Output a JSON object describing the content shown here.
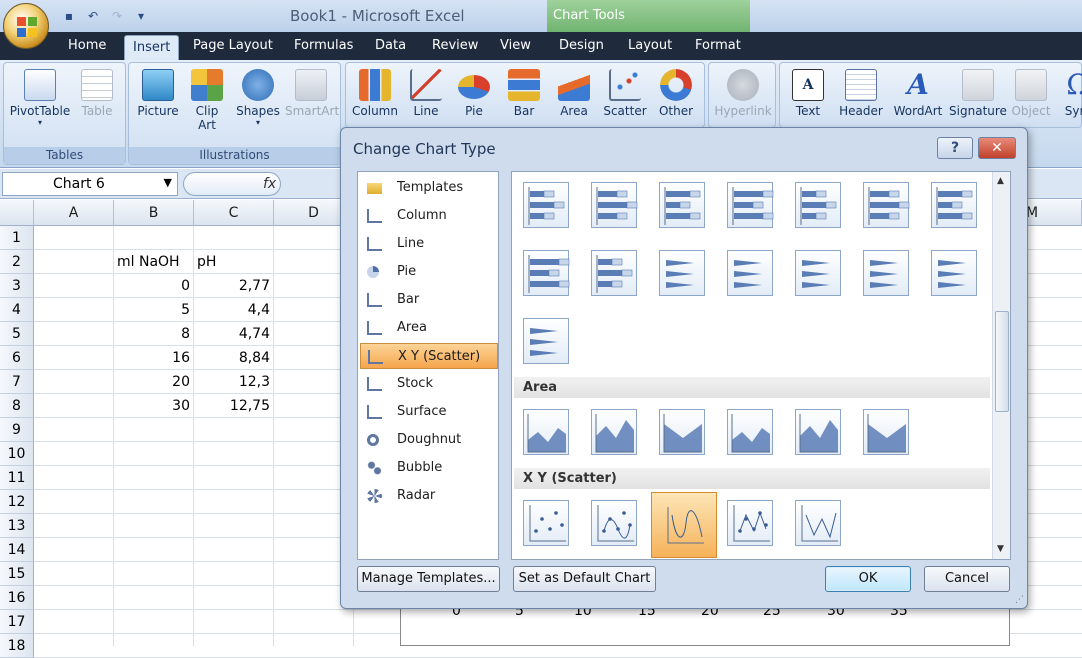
{
  "window": {
    "title": "Book1 - Microsoft Excel",
    "contextual_tab_group": "Chart Tools"
  },
  "tabs": [
    "Home",
    "Insert",
    "Page Layout",
    "Formulas",
    "Data",
    "Review",
    "View",
    "Design",
    "Layout",
    "Format"
  ],
  "active_tab": "Insert",
  "ribbon": {
    "groups": {
      "tables": "Tables",
      "illustrations": "Illustrations"
    },
    "tables": [
      "PivotTable",
      "Table"
    ],
    "illustrations": [
      "Picture",
      "Clip Art",
      "Shapes",
      "SmartArt"
    ],
    "charts": [
      "Column",
      "Line",
      "Pie",
      "Bar",
      "Area",
      "Scatter",
      "Other"
    ],
    "links": [
      "Hyperlink"
    ],
    "text": [
      "Text",
      "Header",
      "WordArt",
      "Signature",
      "Object",
      "Sym"
    ]
  },
  "formula_bar": {
    "name_box": "Chart 6",
    "fx": "fx"
  },
  "sheet": {
    "columns": [
      "A",
      "B",
      "C",
      "D",
      "M"
    ],
    "rows": [
      "1",
      "2",
      "3",
      "4",
      "5",
      "6",
      "7",
      "8",
      "9",
      "10",
      "11",
      "12",
      "13",
      "14",
      "15",
      "16",
      "17",
      "18"
    ],
    "header_b": "ml NaOH",
    "header_c": "pH",
    "data": [
      {
        "b": "0",
        "c": "2,77"
      },
      {
        "b": "5",
        "c": "4,4"
      },
      {
        "b": "8",
        "c": "4,74"
      },
      {
        "b": "16",
        "c": "8,84"
      },
      {
        "b": "20",
        "c": "12,3"
      },
      {
        "b": "30",
        "c": "12,75"
      }
    ],
    "chart_x_ticks": [
      "0",
      "5",
      "10",
      "15",
      "20",
      "25",
      "30",
      "35"
    ]
  },
  "dialog": {
    "title": "Change Chart Type",
    "help": "?",
    "close": "✕",
    "chart_types": [
      "Templates",
      "Column",
      "Line",
      "Pie",
      "Bar",
      "Area",
      "X Y (Scatter)",
      "Stock",
      "Surface",
      "Doughnut",
      "Bubble",
      "Radar"
    ],
    "selected_type": "X Y (Scatter)",
    "sections": {
      "area": "Area",
      "scatter": "X Y (Scatter)"
    },
    "buttons": {
      "manage": "Manage Templates...",
      "default": "Set as Default Chart",
      "ok": "OK",
      "cancel": "Cancel"
    }
  },
  "colors": {
    "accent": "#f5a54c",
    "ribbon": "#c5d8ee",
    "chart_tools": "#6fb36e"
  }
}
